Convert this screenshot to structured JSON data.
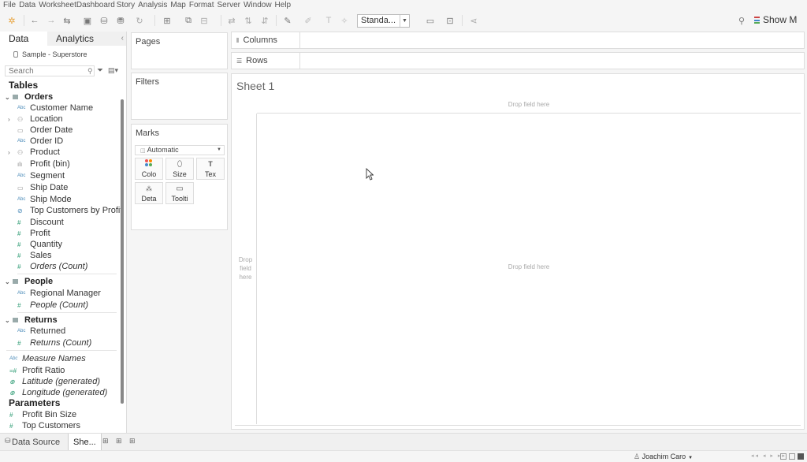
{
  "menu": [
    "File",
    "Data",
    "Worksheet",
    "Dashboard",
    "Story",
    "Analysis",
    "Map",
    "Format",
    "Server",
    "Window",
    "Help"
  ],
  "toolbar": {
    "fit_select": "Standa...",
    "show_me": "Show M"
  },
  "data_pane": {
    "tab_data": "Data",
    "tab_analytics": "Analytics",
    "datasource": "Sample - Superstore",
    "search_placeholder": "Search",
    "tables_heading": "Tables",
    "groups": [
      {
        "name": "Orders",
        "fields": [
          "Customer Name",
          "Location",
          "Order Date",
          "Order ID",
          "Product",
          "Profit (bin)",
          "Segment",
          "Ship Date",
          "Ship Mode",
          "Top Customers by Profit",
          "Discount",
          "Profit",
          "Quantity",
          "Sales",
          "Orders (Count)"
        ]
      },
      {
        "name": "People",
        "fields": [
          "Regional Manager",
          "People (Count)"
        ]
      },
      {
        "name": "Returns",
        "fields": [
          "Returned",
          "Returns (Count)"
        ]
      }
    ],
    "extra_fields": [
      "Measure Names",
      "Profit Ratio",
      "Latitude (generated)",
      "Longitude (generated)"
    ],
    "parameters_heading": "Parameters",
    "parameters": [
      "Profit Bin Size",
      "Top Customers"
    ]
  },
  "cards": {
    "pages": "Pages",
    "filters": "Filters",
    "marks": "Marks",
    "mark_type": "Automatic",
    "mark_buttons": [
      "Colo",
      "Size",
      "Tex",
      "Deta",
      "Toolti"
    ]
  },
  "shelves": {
    "columns": "Columns",
    "rows": "Rows"
  },
  "canvas": {
    "title": "Sheet 1",
    "drop_top": "Drop field here",
    "drop_left": [
      "Drop",
      "field",
      "here"
    ],
    "drop_main": "Drop field here"
  },
  "bottom_tabs": {
    "data_source": "Data Source",
    "sheet": "She..."
  },
  "status": {
    "user": "Joachim Caro"
  }
}
